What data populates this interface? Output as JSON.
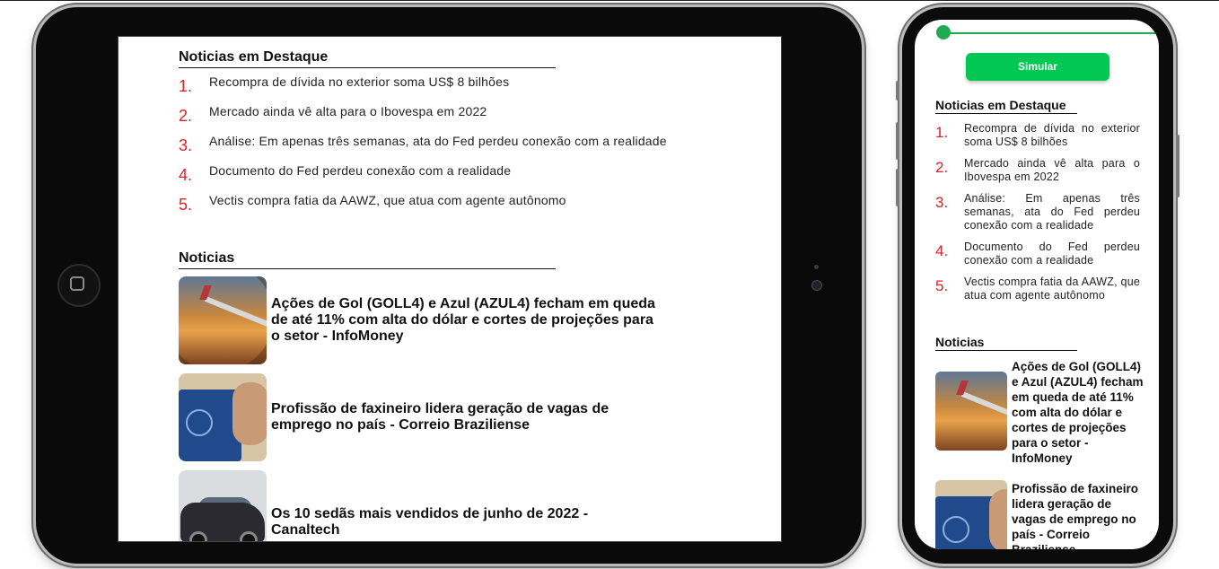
{
  "tablet": {
    "highlights_heading": "Noticias em Destaque",
    "highlights": [
      {
        "num": "1.",
        "text": "Recompra de dívida no exterior soma US$ 8 bilhões"
      },
      {
        "num": "2.",
        "text": "Mercado ainda vê alta para o Ibovespa em 2022"
      },
      {
        "num": "3.",
        "text": "Análise: Em apenas três semanas, ata do Fed perdeu conexão com a realidade"
      },
      {
        "num": "4.",
        "text": "Documento do Fed perdeu conexão com a realidade"
      },
      {
        "num": "5.",
        "text": "Vectis compra fatia da AAWZ, que atua com agente autônomo"
      }
    ],
    "news_heading": "Noticias",
    "news": [
      {
        "title": "Ações de Gol (GOLL4) e Azul (AZUL4) fecham em queda de até 11% com alta do dólar e cortes de projeções para o setor - InfoMoney"
      },
      {
        "title": "Profissão de faxineiro lidera geração de vagas de emprego no país - Correio Braziliense"
      },
      {
        "title": "Os 10 sedãs mais vendidos de junho de 2022 - Canaltech"
      }
    ]
  },
  "phone": {
    "simulate_label": "Simular",
    "highlights_heading": "Noticias em Destaque",
    "highlights": [
      {
        "num": "1.",
        "text": "Recompra de dívida no exterior soma US$ 8 bilhões"
      },
      {
        "num": "2.",
        "text": "Mercado ainda vê alta para o Ibovespa em 2022"
      },
      {
        "num": "3.",
        "text": "Análise: Em apenas três semanas, ata do Fed perdeu conexão com a realidade"
      },
      {
        "num": "4.",
        "text": "Documento do Fed perdeu conexão com a realidade"
      },
      {
        "num": "5.",
        "text": "Vectis compra fatia da AAWZ, que atua com agente autônomo"
      }
    ],
    "news_heading": "Noticias",
    "news": [
      {
        "title": "Ações de Gol (GOLL4) e Azul (AZUL4) fecham em queda de até 11% com alta do dólar e cortes de projeções para o setor - InfoMoney"
      },
      {
        "title": "Profissão de faxineiro lidera geração de vagas de emprego no país - Correio Braziliense"
      }
    ]
  },
  "colors": {
    "accent_green": "#00c853",
    "number_red": "#e0202a"
  }
}
